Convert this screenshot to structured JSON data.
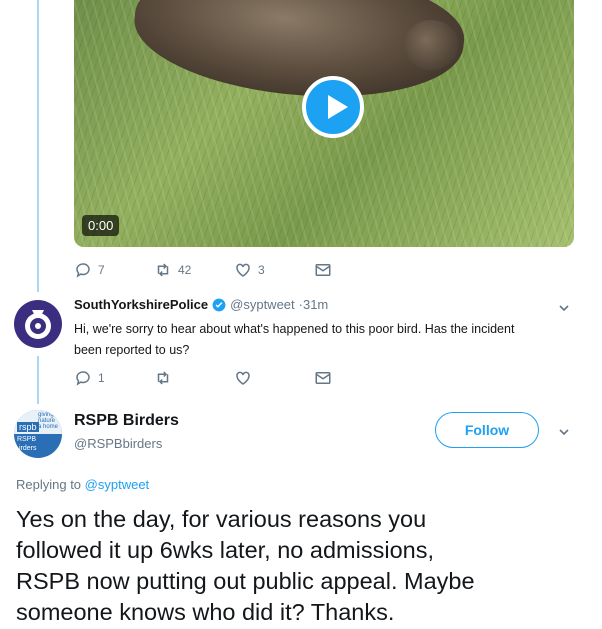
{
  "media": {
    "duration": "0:00"
  },
  "tweet1_actions": {
    "replies": "7",
    "retweets": "42",
    "likes": "3"
  },
  "reply1": {
    "name": "SouthYorkshirePolice",
    "handle": "@syptweet",
    "time": "·31m",
    "text_line1": "Hi, we're sorry to hear about what's happened to this poor bird. Has the incident",
    "text_line2": "been reported to us?",
    "replies": "1"
  },
  "main_tweet": {
    "name": "RSPB Birders",
    "handle": "@RSPBbirders",
    "follow_label": "Follow",
    "replying_prefix": "Replying to",
    "replying_to": "@syptweet",
    "text_line1": "Yes on the day, for various reasons you",
    "text_line2": "followed it up 6wks later, no admissions,",
    "text_line3": "RSPB now putting out public appeal. Maybe",
    "text_line4": "someone knows who did it? Thanks.",
    "avatar_text": {
      "t1": "giving",
      "t2": "nature",
      "t3": "a home",
      "t4": "rspb",
      "t5": "RSPB",
      "t6": "irders"
    }
  },
  "colors": {
    "accent": "#1da1f2",
    "thread_line": "#a9d7f5",
    "muted": "#657786"
  },
  "icons": [
    "play-icon",
    "reply-icon",
    "retweet-icon",
    "like-icon",
    "message-icon",
    "verified-icon",
    "chevron-down-icon"
  ]
}
